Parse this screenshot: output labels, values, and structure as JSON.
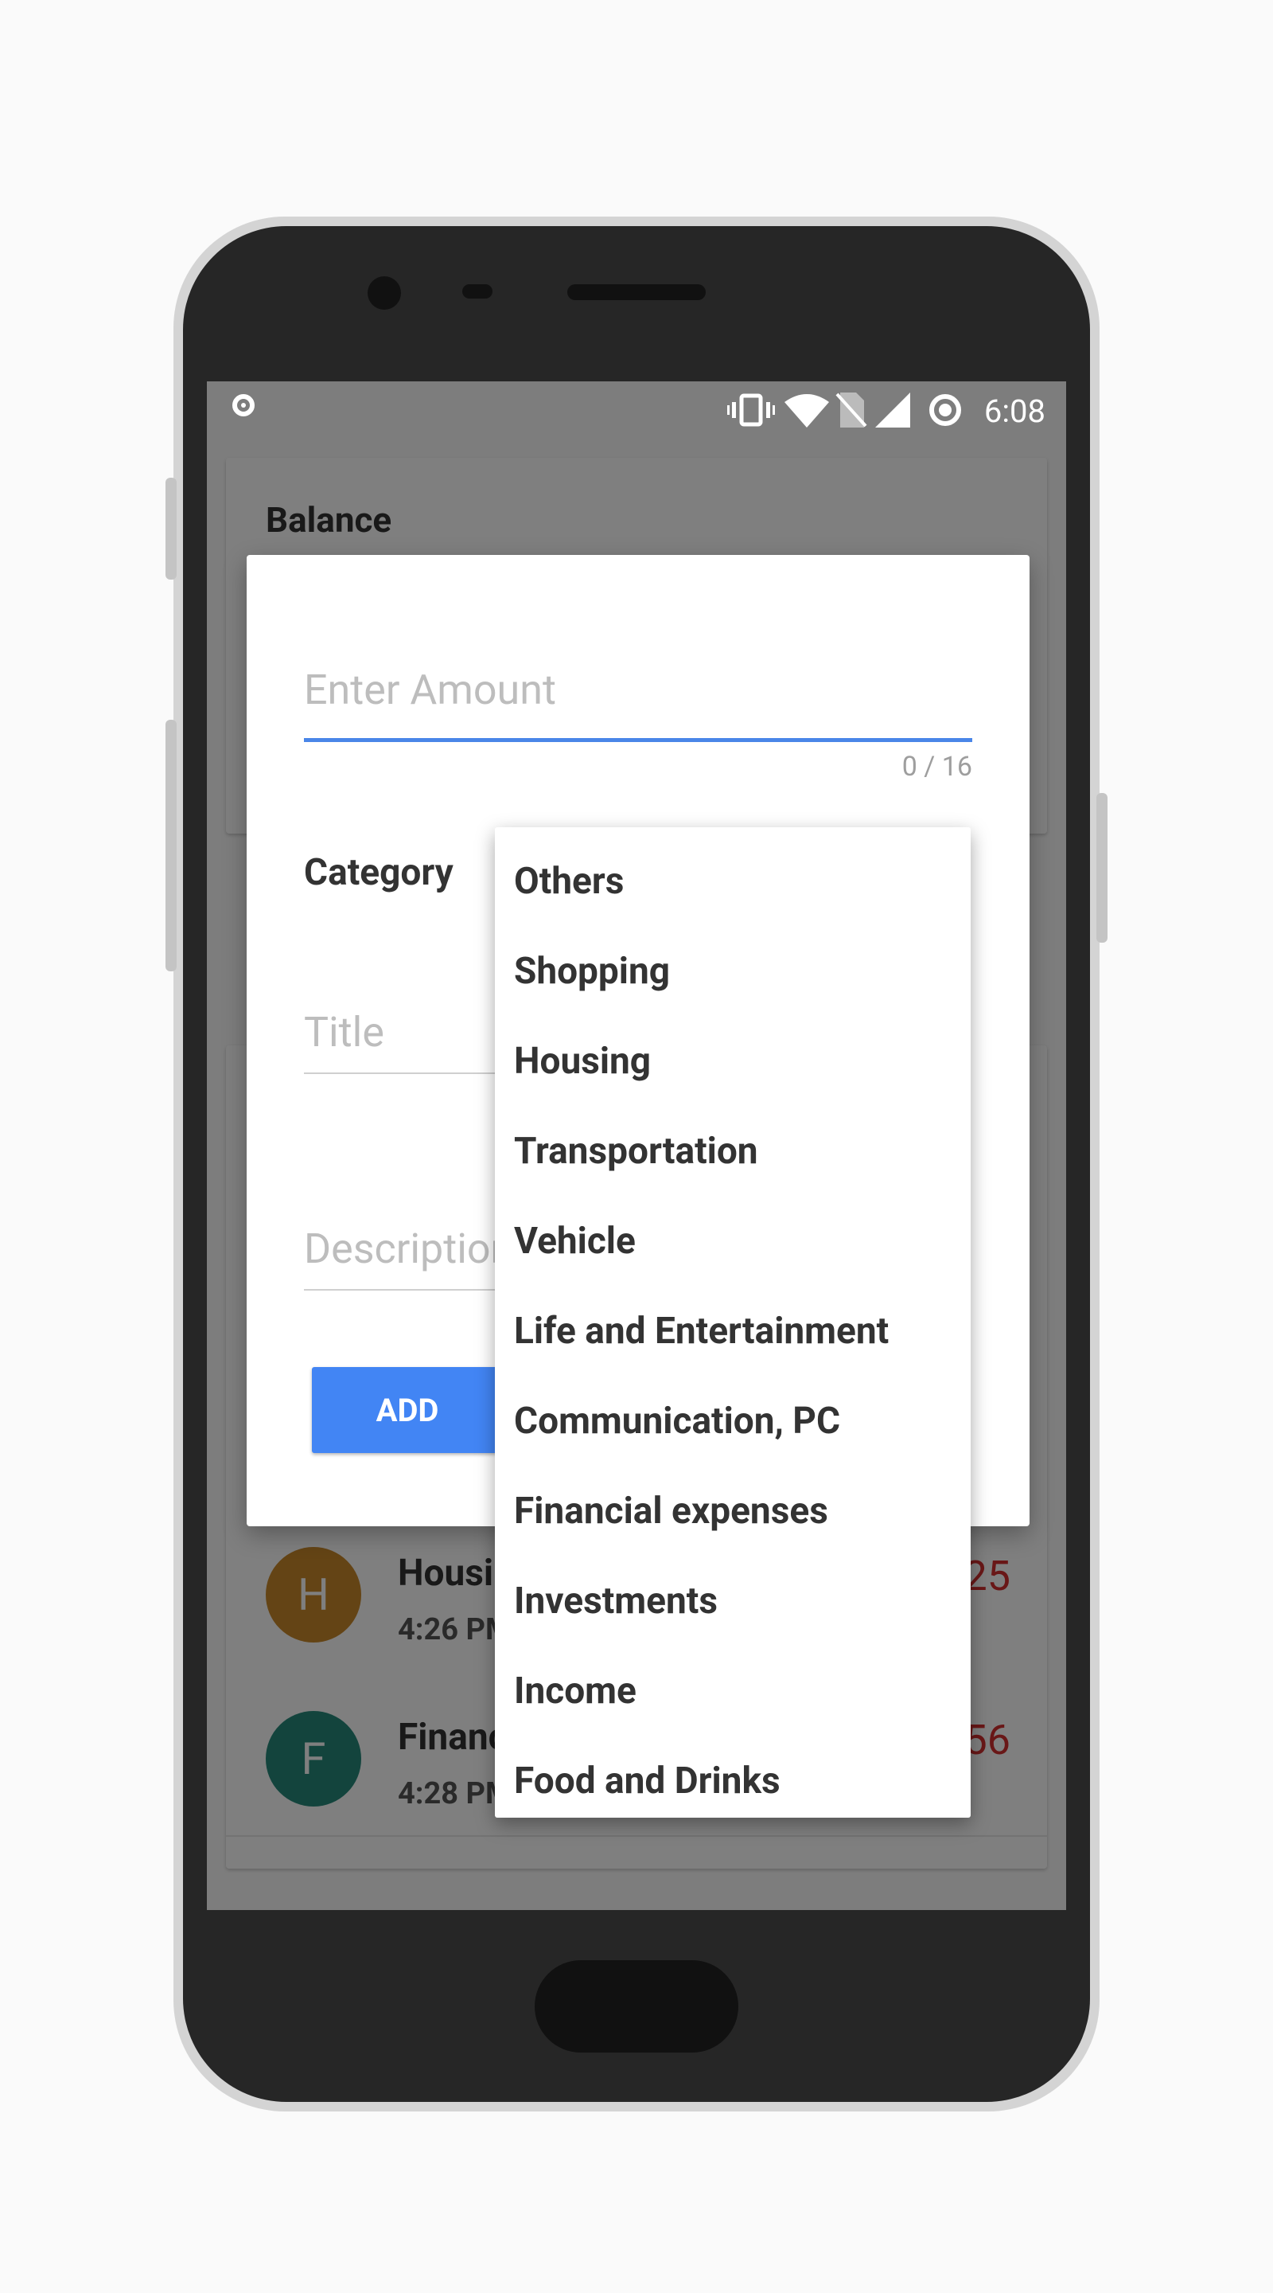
{
  "status_bar": {
    "time": "6:08"
  },
  "balance_card": {
    "title": "Balance"
  },
  "transactions": [
    {
      "initial": "H",
      "title": "Housi",
      "time": "4:26 PM",
      "amount": "25",
      "color": "#c8882b"
    },
    {
      "initial": "F",
      "title": "Financ",
      "time": "4:28 PM",
      "amount": "56",
      "color": "#27897a"
    }
  ],
  "dialog": {
    "amount_placeholder": "Enter Amount",
    "counter": "0 / 16",
    "category_label": "Category",
    "title_placeholder": "Title",
    "description_placeholder": "Description",
    "add_button": "ADD",
    "accent_color": "#4a86e8"
  },
  "category_dropdown": {
    "options": [
      "Others",
      "Shopping",
      "Housing",
      "Transportation",
      "Vehicle",
      "Life and Entertainment",
      "Communication, PC",
      "Financial expenses",
      "Investments",
      "Income",
      "Food and Drinks"
    ]
  }
}
